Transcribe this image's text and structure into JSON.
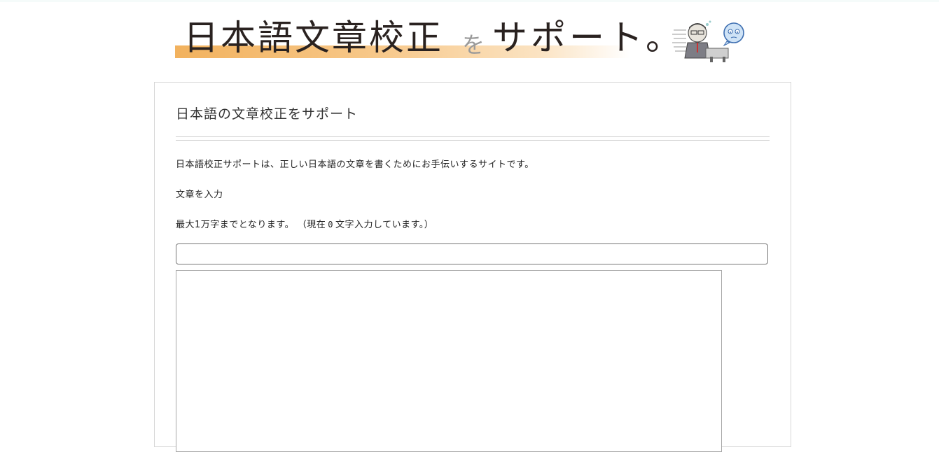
{
  "header": {
    "banner_main": "日本語文章校正",
    "banner_particle": "を",
    "banner_rest": "サポート。",
    "mascot_icon": "worried-writer-illustration",
    "accent_color": "#f2b25e"
  },
  "main": {
    "page_title": "日本語の文章校正をサポート",
    "intro_text": "日本語校正サポートは、正しい日本語の文章を書くためにお手伝いするサイトです。",
    "input_label": "文章を入力",
    "limit_prefix": "最大1万字までとなります。 （現在",
    "char_count": "0",
    "limit_suffix": "文字入力しています。）",
    "title_input_value": "",
    "body_textarea_value": ""
  }
}
